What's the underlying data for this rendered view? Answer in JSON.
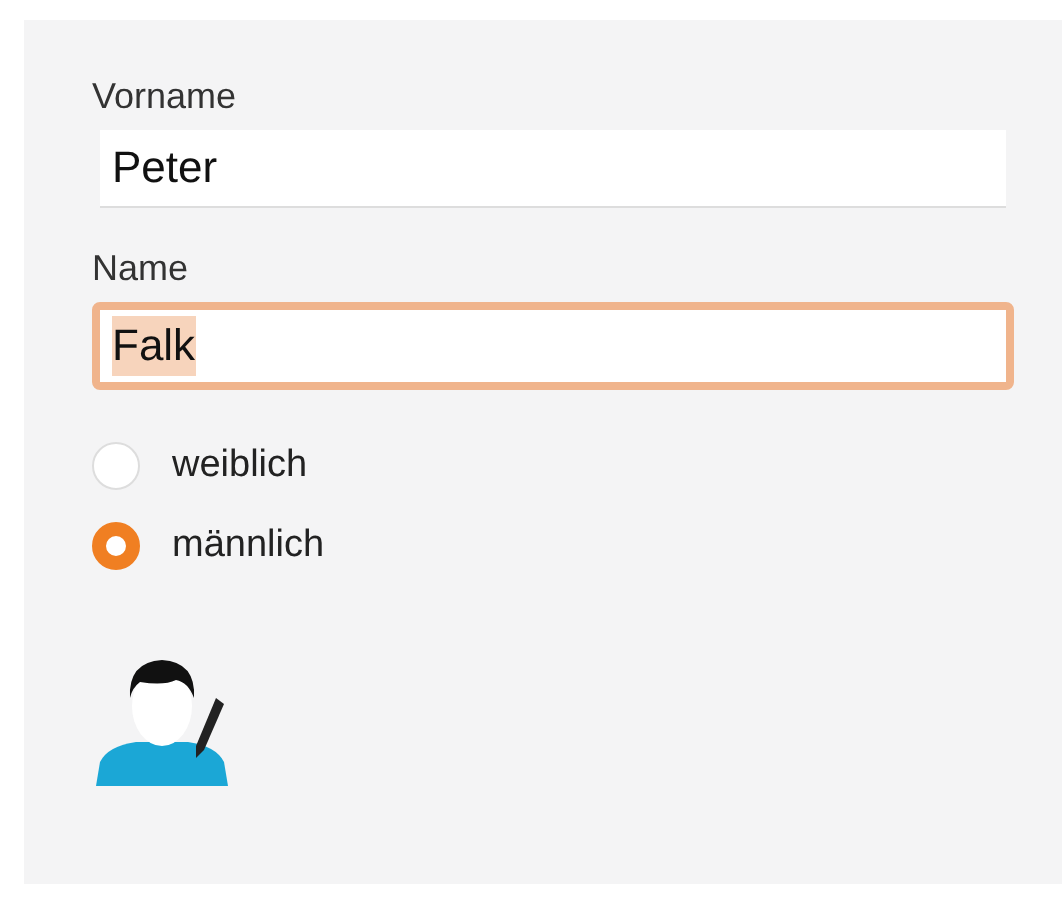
{
  "fields": [
    {
      "label": "Vorname",
      "value": "Peter",
      "focused": false,
      "text_selected": false
    },
    {
      "label": "Name",
      "value": "Falk",
      "focused": true,
      "text_selected": true
    }
  ],
  "gender_options": [
    {
      "label": "weiblich",
      "selected": false
    },
    {
      "label": "männlich",
      "selected": true
    }
  ]
}
